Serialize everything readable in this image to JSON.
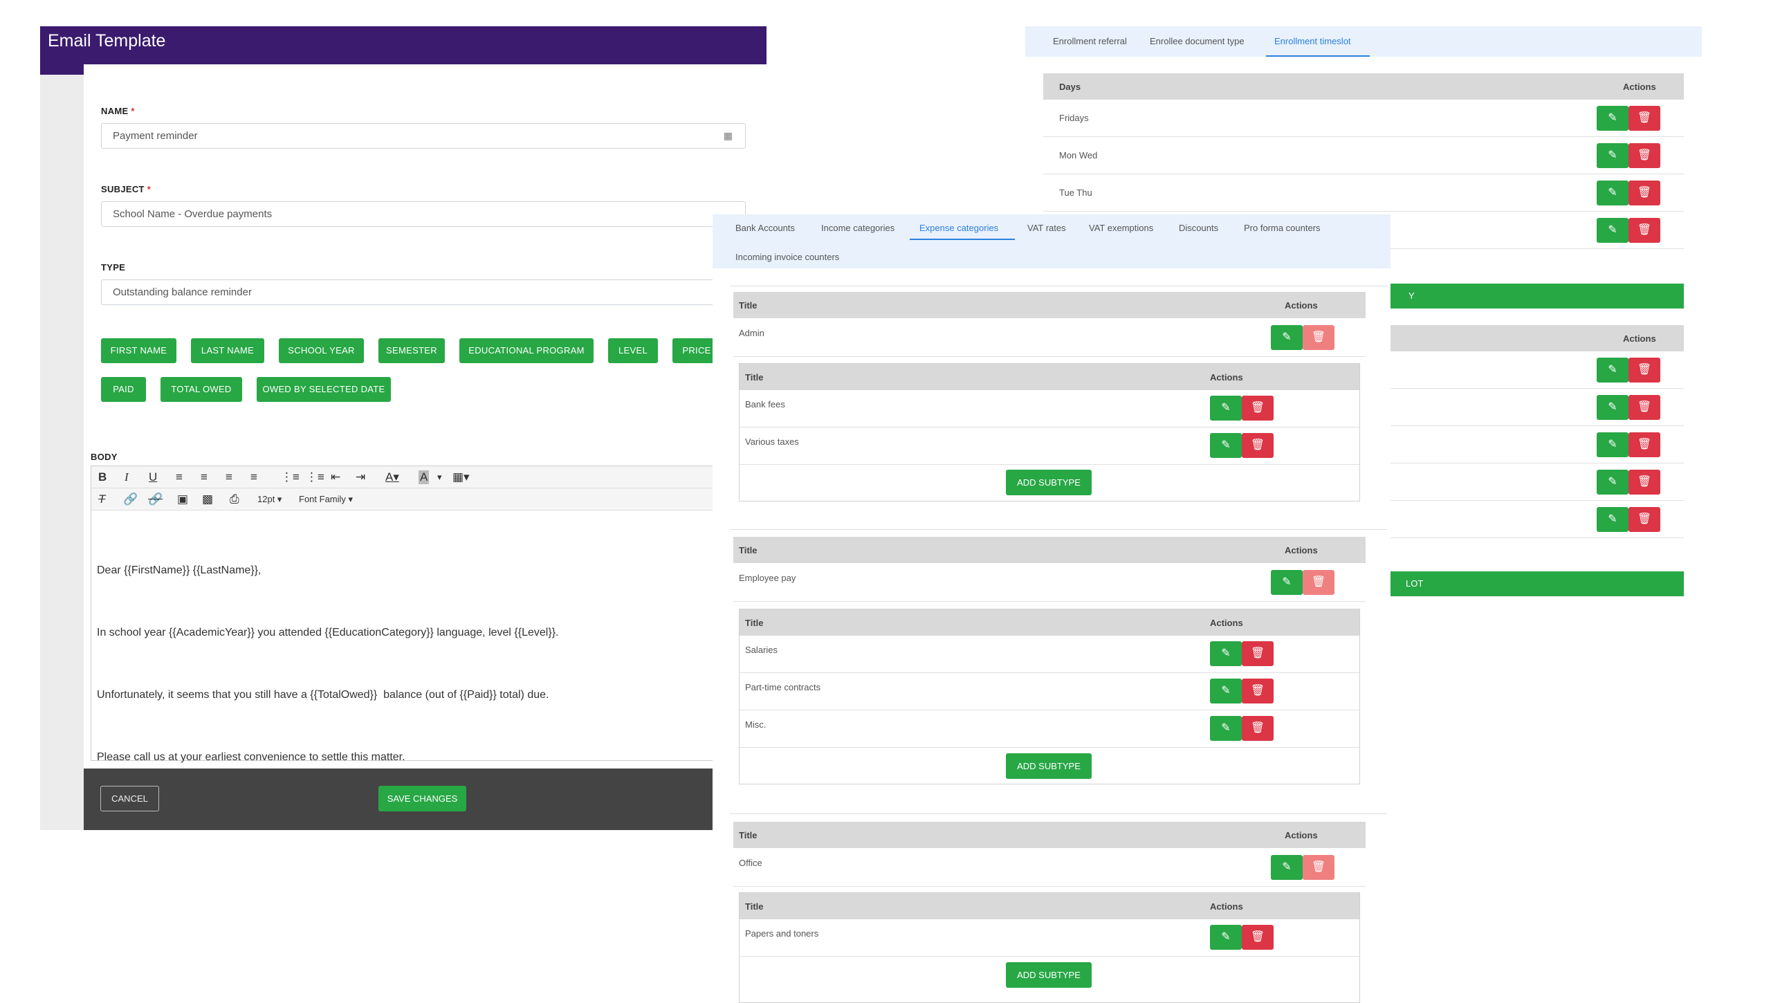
{
  "email_template": {
    "title": "Email Template",
    "name_label": "NAME",
    "name_value": "Payment reminder",
    "subject_label": "SUBJECT",
    "subject_value": "School Name - Overdue payments",
    "type_label": "TYPE",
    "type_value": "Outstanding balance reminder",
    "required_mark": "*",
    "placeholders": [
      "FIRST NAME",
      "LAST NAME",
      "SCHOOL YEAR",
      "SEMESTER",
      "EDUCATIONAL PROGRAM",
      "LEVEL",
      "PRICE",
      "PAID",
      "TOTAL OWED",
      "OWED BY SELECTED DATE"
    ],
    "body_label": "BODY",
    "font_size": "12pt",
    "font_family": "Font Family",
    "body_lines": [
      "Dear {{FirstName}} {{LastName}},",
      "In school year {{AcademicYear}} you attended {{EducationCategory}} language, level {{Level}}.",
      "Unfortunately, it seems that you still have a {{TotalOwed}}  balance (out of {{Paid}} total) due.",
      "Please call us at your earliest convenience to settle this matter."
    ],
    "cancel_label": "CANCEL",
    "save_label": "SAVE CHANGES"
  },
  "enrollment": {
    "tabs": [
      "Enrollment referral",
      "Enrollee document type",
      "Enrollment timeslot"
    ],
    "active_tab": "Enrollment timeslot",
    "days_header": "Days",
    "actions_header": "Actions",
    "rows": [
      "Fridays",
      "Mon Wed",
      "Tue Thu"
    ],
    "bar1_text": "Y",
    "bar2_text": "LOT"
  },
  "expense": {
    "tabs": [
      "Bank Accounts",
      "Income categories",
      "Expense categories",
      "VAT rates",
      "VAT exemptions",
      "Discounts",
      "Pro forma counters",
      "Incoming invoice counters"
    ],
    "active_tab": "Expense categories",
    "title_header": "Title",
    "actions_header": "Actions",
    "add_subtype_label": "ADD SUBTYPE",
    "categories": [
      {
        "title": "Admin",
        "subtypes": [
          "Bank fees",
          "Various taxes"
        ]
      },
      {
        "title": "Employee pay",
        "subtypes": [
          "Salaries",
          "Part-time contracts",
          "Misc."
        ]
      },
      {
        "title": "Office",
        "subtypes": [
          "Papers and toners"
        ]
      }
    ]
  },
  "colors": {
    "title_bar": "#3a1b6e",
    "green": "#28a745",
    "red": "#dc3545",
    "accent_blue": "#2d7fe0",
    "tab_bg": "#e8f1fc"
  },
  "icons": {
    "edit": "pencil-icon",
    "delete": "trash-icon"
  }
}
